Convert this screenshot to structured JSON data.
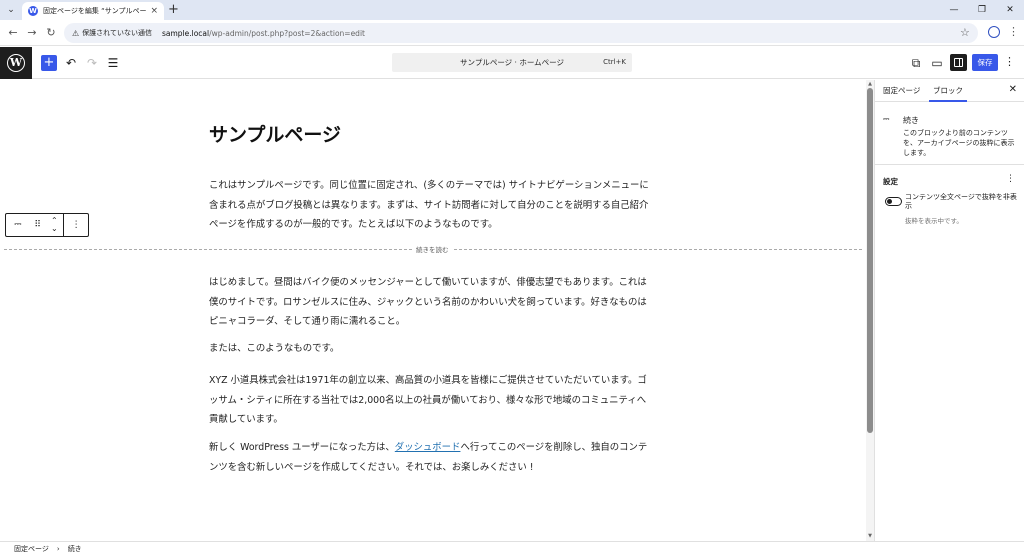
{
  "browser": {
    "tab_menu": "⌄",
    "tab_title": "固定ページを編集 “サンプルページ”",
    "tab_close": "×",
    "new_tab": "+",
    "window_minimize": "—",
    "window_restore": "❐",
    "window_close": "✕",
    "back": "←",
    "forward": "→",
    "reload": "↻",
    "security_warning": "保護されていない通信",
    "url_host": "sample.local",
    "url_path": "/wp-admin/post.php?post=2&action=edit"
  },
  "header": {
    "logo_letter": "W",
    "add_block": "+",
    "undo": "↶",
    "redo": "↷",
    "list_view": "☰",
    "command_bar_title": "サンプルページ · ホームページ",
    "command_bar_shortcut": "Ctrl+K",
    "view_page": "⧉",
    "preview": "▭",
    "save_label": "保存",
    "options": "⋮"
  },
  "content": {
    "title": "サンプルページ",
    "paragraphs": [
      "これはサンプルページです。同じ位置に固定され、(多くのテーマでは) サイトナビゲーションメニューに含まれる点がブログ投稿とは異なります。まずは、サイト訪問者に対して自分のことを説明する自己紹介ページを作成するのが一般的です。たとえば以下のようなものです。",
      "はじめまして。昼間はバイク便のメッセンジャーとして働いていますが、俳優志望でもあります。これは僕のサイトです。ロサンゼルスに住み、ジャックという名前のかわいい犬を飼っています。好きなものはピニャコラーダ、そして通り雨に濡れること。",
      "または、このようなものです。",
      "XYZ 小道具株式会社は1971年の創立以来、高品質の小道具を皆様にご提供させていただいています。ゴッサム・シティに所在する当社では2,000名以上の社員が働いており、様々な形で地域のコミュニティへ貢献しています。"
    ],
    "last_para_before": "新しく WordPress ユーザーになった方は、",
    "last_para_link": "ダッシュボード",
    "last_para_after": "へ行ってこのページを削除し、独自のコンテンツを含む新しいページを作成してください。それでは、お楽しみください !",
    "more_label": "続きを読む"
  },
  "block_toolbar": {
    "block_icon": "⎓",
    "drag": "⠿",
    "move_up": "⌃",
    "move_down": "⌄",
    "options": "⋮"
  },
  "sidebar": {
    "tab_page": "固定ページ",
    "tab_block": "ブロック",
    "close": "✕",
    "block_icon": "⎓",
    "block_name": "続き",
    "block_description": "このブロックより前のコンテンツを、アーカイブページの抜粋に表示します。",
    "settings_title": "設定",
    "settings_options": "⋮",
    "toggle_label": "コンテンツ全文ページで抜粋を非表示",
    "toggle_help": "抜粋を表示中です。"
  },
  "footer": {
    "crumb_1": "固定ページ",
    "separator": "›",
    "crumb_2": "続き"
  }
}
